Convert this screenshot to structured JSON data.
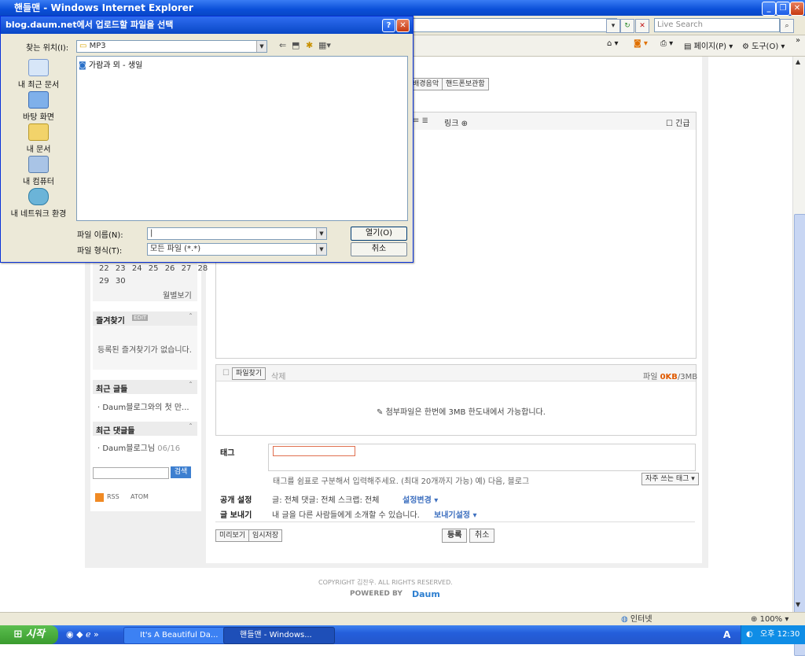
{
  "window": {
    "title": "핸들맨 - Windows Internet Explorer"
  },
  "browser": {
    "search_placeholder": "Live Search",
    "toolbar_page": "페이지(P)",
    "toolbar_tools": "도구(O)"
  },
  "editor": {
    "topbuttons": [
      "배경음악",
      "핸드폰보관함"
    ],
    "format_link": "링크",
    "urgent_label": "긴급",
    "calendar_row1": [
      "22",
      "23",
      "24",
      "25",
      "26",
      "27",
      "28"
    ],
    "calendar_row2": [
      "29",
      "30"
    ],
    "calendar_more": "월별보기",
    "favorites_title": "즐겨찾기",
    "favorites_badge": "EDIT",
    "favorites_empty": "등록된 즐겨찾기가 없습니다.",
    "recent_posts_title": "최근 글들",
    "recent_post": "· Daum블로그와의 첫 만...",
    "recent_comments_title": "최근 댓글들",
    "recent_comment_author": "· Daum블로그님",
    "recent_comment_date": "06/16",
    "search_button": "검색",
    "rss": "RSS",
    "atom": "ATOM",
    "attach_find": "파일찾기",
    "attach_delete": "삭제",
    "attach_size_label": "파일",
    "attach_size_used": "0KB",
    "attach_size_total": "/3MB",
    "attach_note": "첨부파일은 한번에 3MB 한도내에서 가능합니다.",
    "tag_label": "태그",
    "tag_hint": "태그를 쉼표로 구분해서 입력해주세요. (최대 20개까지 가능) 예) 다음, 블로그",
    "tag_frequent": "자주 쓰는 태그",
    "public_label": "공개 설정",
    "public_values": "글: 전체  댓글: 전체  스크랩: 전체",
    "public_change": "설정변경",
    "send_label": "글 보내기",
    "send_desc": "내 글을 다른 사람들에게 소개할 수 있습니다.",
    "send_setting": "보내기설정",
    "preview": "미리보기",
    "temp_save": "임시저장",
    "submit": "등록",
    "cancel": "취소",
    "copyright": "COPYRIGHT 김찬우. ALL RIGHTS RESERVED.",
    "powered": "POWERED BY",
    "powered_logo": "Daum"
  },
  "dialog": {
    "title": "blog.daum.net에서 업로드할 파일을 선택",
    "lookin_label": "찾는 위치(I):",
    "lookin_value": "MP3",
    "places": [
      "내 최근 문서",
      "바탕 화면",
      "내 문서",
      "내 컴퓨터",
      "내 네트워크 환경"
    ],
    "files": [
      "가람과 뫼 - 생일"
    ],
    "filename_label": "파일 이름(N):",
    "filename_value": "",
    "filetype_label": "파일 형식(T):",
    "filetype_value": "모든 파일 (*.*)",
    "open_button": "열기(O)",
    "cancel_button": "취소"
  },
  "statusbar": {
    "zone": "인터넷",
    "zoom": "100%"
  },
  "taskbar": {
    "start": "시작",
    "items": [
      "It's A Beautiful Da...",
      "핸들맨 - Windows..."
    ],
    "clock": "오후 12:30",
    "ime": "A"
  },
  "colors": {
    "xp_blue": "#0a4fd8",
    "start_green": "#3a9b2e",
    "accent_orange": "#e05a00"
  }
}
